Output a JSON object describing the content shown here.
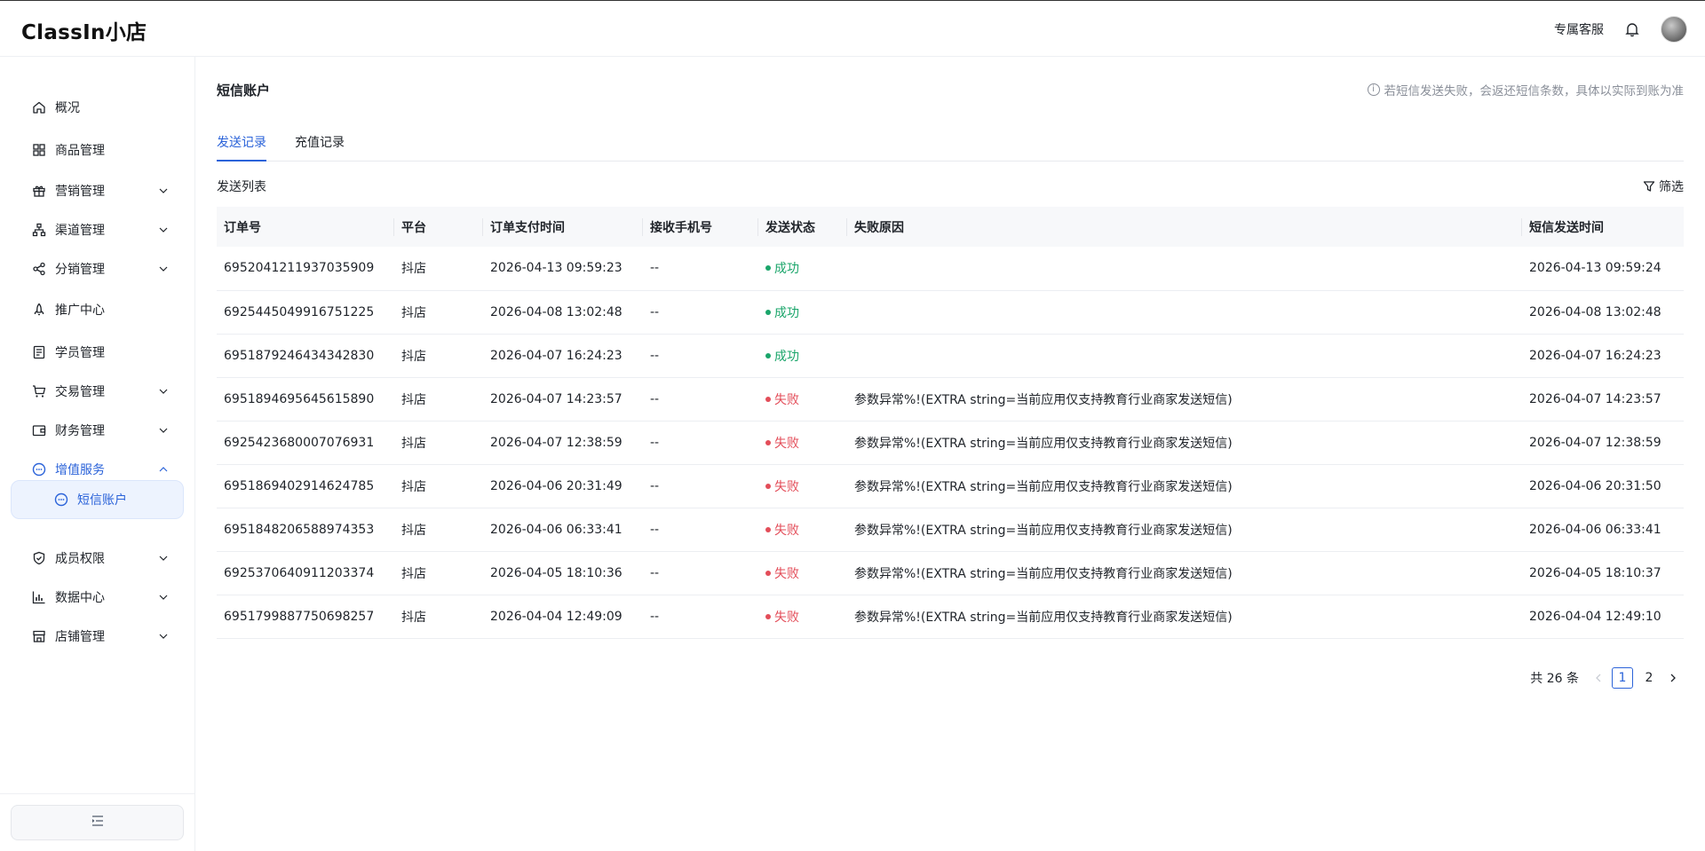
{
  "app": {
    "logo": "ClassIn小店",
    "support": "专属客服"
  },
  "sidebar": {
    "items": [
      {
        "label": "概况",
        "icon": "home-icon",
        "expandable": false
      },
      {
        "label": "商品管理",
        "icon": "grid-icon",
        "expandable": false
      },
      {
        "label": "营销管理",
        "icon": "gift-icon",
        "expandable": true
      },
      {
        "label": "渠道管理",
        "icon": "channel-icon",
        "expandable": true
      },
      {
        "label": "分销管理",
        "icon": "share-icon",
        "expandable": true
      },
      {
        "label": "推广中心",
        "icon": "rocket-icon",
        "expandable": false
      },
      {
        "label": "学员管理",
        "icon": "student-icon",
        "expandable": false
      },
      {
        "label": "交易管理",
        "icon": "cart-icon",
        "expandable": true
      },
      {
        "label": "财务管理",
        "icon": "wallet-icon",
        "expandable": true
      },
      {
        "label": "增值服务",
        "icon": "chat-icon",
        "expandable": true,
        "active": true
      },
      {
        "label": "成员权限",
        "icon": "shield-icon",
        "expandable": true
      },
      {
        "label": "数据中心",
        "icon": "chart-icon",
        "expandable": true
      },
      {
        "label": "店铺管理",
        "icon": "store-icon",
        "expandable": true
      }
    ],
    "sub_item": {
      "label": "短信账户",
      "icon": "chat-icon"
    }
  },
  "page": {
    "title": "短信账户",
    "notice": "若短信发送失败，会返还短信条数，具体以实际到账为准",
    "tabs": [
      "发送记录",
      "充值记录"
    ],
    "active_tab": 0,
    "section_title": "发送列表",
    "filter_label": "筛选"
  },
  "table": {
    "columns": [
      "订单号",
      "平台",
      "订单支付时间",
      "接收手机号",
      "发送状态",
      "失败原因",
      "短信发送时间"
    ],
    "rows": [
      {
        "order": "6952041211937035909",
        "platform": "抖店",
        "pay_time": "2026-04-13 09:59:23",
        "phone": "--",
        "status": "成功",
        "status_type": "ok",
        "reason": "",
        "send_time": "2026-04-13 09:59:24"
      },
      {
        "order": "6925445049916751225",
        "platform": "抖店",
        "pay_time": "2026-04-08 13:02:48",
        "phone": "--",
        "status": "成功",
        "status_type": "ok",
        "reason": "",
        "send_time": "2026-04-08 13:02:48"
      },
      {
        "order": "6951879246434342830",
        "platform": "抖店",
        "pay_time": "2026-04-07 16:24:23",
        "phone": "--",
        "status": "成功",
        "status_type": "ok",
        "reason": "",
        "send_time": "2026-04-07 16:24:23"
      },
      {
        "order": "6951894695645615890",
        "platform": "抖店",
        "pay_time": "2026-04-07 14:23:57",
        "phone": "--",
        "status": "失败",
        "status_type": "fail",
        "reason": "参数异常%!(EXTRA string=当前应用仅支持教育行业商家发送短信)",
        "send_time": "2026-04-07 14:23:57"
      },
      {
        "order": "6925423680007076931",
        "platform": "抖店",
        "pay_time": "2026-04-07 12:38:59",
        "phone": "--",
        "status": "失败",
        "status_type": "fail",
        "reason": "参数异常%!(EXTRA string=当前应用仅支持教育行业商家发送短信)",
        "send_time": "2026-04-07 12:38:59"
      },
      {
        "order": "6951869402914624785",
        "platform": "抖店",
        "pay_time": "2026-04-06 20:31:49",
        "phone": "--",
        "status": "失败",
        "status_type": "fail",
        "reason": "参数异常%!(EXTRA string=当前应用仅支持教育行业商家发送短信)",
        "send_time": "2026-04-06 20:31:50"
      },
      {
        "order": "6951848206588974353",
        "platform": "抖店",
        "pay_time": "2026-04-06 06:33:41",
        "phone": "--",
        "status": "失败",
        "status_type": "fail",
        "reason": "参数异常%!(EXTRA string=当前应用仅支持教育行业商家发送短信)",
        "send_time": "2026-04-06 06:33:41"
      },
      {
        "order": "6925370640911203374",
        "platform": "抖店",
        "pay_time": "2026-04-05 18:10:36",
        "phone": "--",
        "status": "失败",
        "status_type": "fail",
        "reason": "参数异常%!(EXTRA string=当前应用仅支持教育行业商家发送短信)",
        "send_time": "2026-04-05 18:10:37"
      },
      {
        "order": "6951799887750698257",
        "platform": "抖店",
        "pay_time": "2026-04-04 12:49:09",
        "phone": "--",
        "status": "失败",
        "status_type": "fail",
        "reason": "参数异常%!(EXTRA string=当前应用仅支持教育行业商家发送短信)",
        "send_time": "2026-04-04 12:49:10"
      }
    ]
  },
  "pagination": {
    "total": "共 26 条",
    "pages": [
      "1",
      "2"
    ],
    "current": "1"
  },
  "colors": {
    "accent": "#2b63d9",
    "success": "#1aa56a",
    "fail": "#e34d59"
  }
}
